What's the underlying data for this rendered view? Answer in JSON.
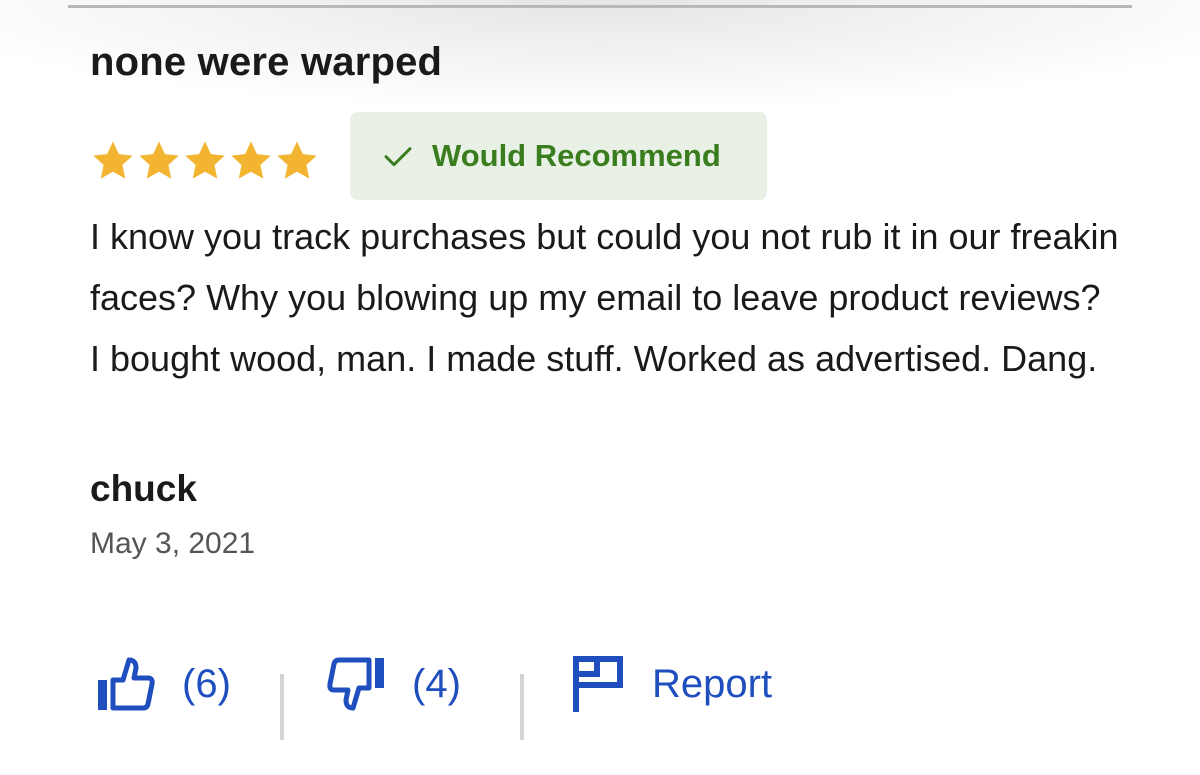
{
  "review": {
    "title": "none were warped",
    "rating": 5,
    "rating_max": 5,
    "recommend_label": "Would Recommend",
    "body": "I know you track purchases but could you not rub it in our freakin faces? Why you blowing up my email to leave product reviews? I bought wood, man. I made stuff. Worked as advertised. Dang.",
    "author": "chuck",
    "date": "May 3, 2021"
  },
  "actions": {
    "helpful_count": "(6)",
    "unhelpful_count": "(4)",
    "report_label": "Report"
  },
  "colors": {
    "star": "#f2b431",
    "recommend_bg": "#e9f1e6",
    "recommend_text": "#3a7d1e",
    "action_blue": "#1f4fbf"
  },
  "icons": {
    "check": "check-icon",
    "thumbs_up": "thumbs-up-icon",
    "thumbs_down": "thumbs-down-icon",
    "flag": "flag-icon"
  }
}
